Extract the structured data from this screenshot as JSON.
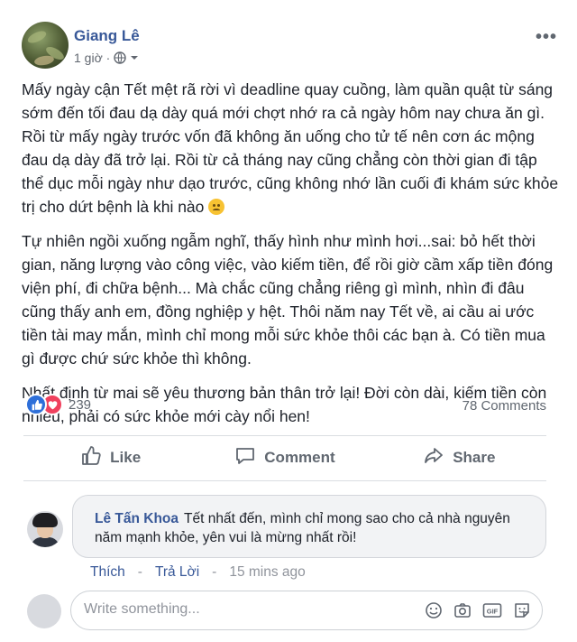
{
  "post": {
    "author": "Giang Lê",
    "time": "1 giờ ·",
    "privacy_icon": "globe-icon",
    "paragraphs": [
      "Mấy ngày cận Tết mệt rã rời vì deadline quay cuồng, làm quần quật từ sáng sớm đến tối đau dạ dày quá mới chợt nhớ ra cả ngày hôm nay chưa ăn gì. Rồi từ mấy ngày trước vốn đã không ăn uống cho tử tế nên cơn ác mộng đau dạ dày đã trở lại. Rồi từ cả tháng nay cũng chẳng còn thời gian đi tập thể dục mỗi ngày như dạo trước, cũng không nhớ lần cuối đi khám sức khỏe trị cho dứt bệnh là khi nào",
      "Tự nhiên ngồi xuống ngẫm nghĩ, thấy hình như mình hơi...sai: bỏ hết thời gian, năng lượng vào công việc, vào kiếm tiền, để rồi giờ cầm xấp tiền đóng viện phí, đi chữa bệnh... Mà chắc cũng chẳng riêng gì mình, nhìn đi đâu cũng thấy anh em, đồng nghiệp y hệt. Thôi năm nay Tết về, ai cầu ai ước tiền tài may mắn, mình chỉ mong mỗi sức khỏe thôi các bạn à. Có tiền mua gì được chứ sức khỏe thì không.",
      "Nhất định từ mai sẽ yêu thương bản thân trở lại! Đời còn dài, kiếm tiền còn nhiều, phải có sức khỏe mới cày nổi hen!"
    ],
    "reaction_count": "239",
    "comments_count": "78 Comments"
  },
  "actions": {
    "like": "Like",
    "comment": "Comment",
    "share": "Share"
  },
  "comment": {
    "author": "Lê Tấn Khoa",
    "text": "Tết nhất đến, mình chỉ mong sao cho cả nhà nguyên năm mạnh khỏe, yên vui là mừng nhất rồi!",
    "like_label": "Thích",
    "reply_label": "Trả Lời",
    "time": "15 mins ago",
    "separator": "-"
  },
  "composer": {
    "placeholder": "Write something..."
  },
  "colors": {
    "link_blue": "#385898",
    "like_blue": "#2e6fd9",
    "love_red": "#f0415e",
    "secondary_text": "#606770"
  }
}
